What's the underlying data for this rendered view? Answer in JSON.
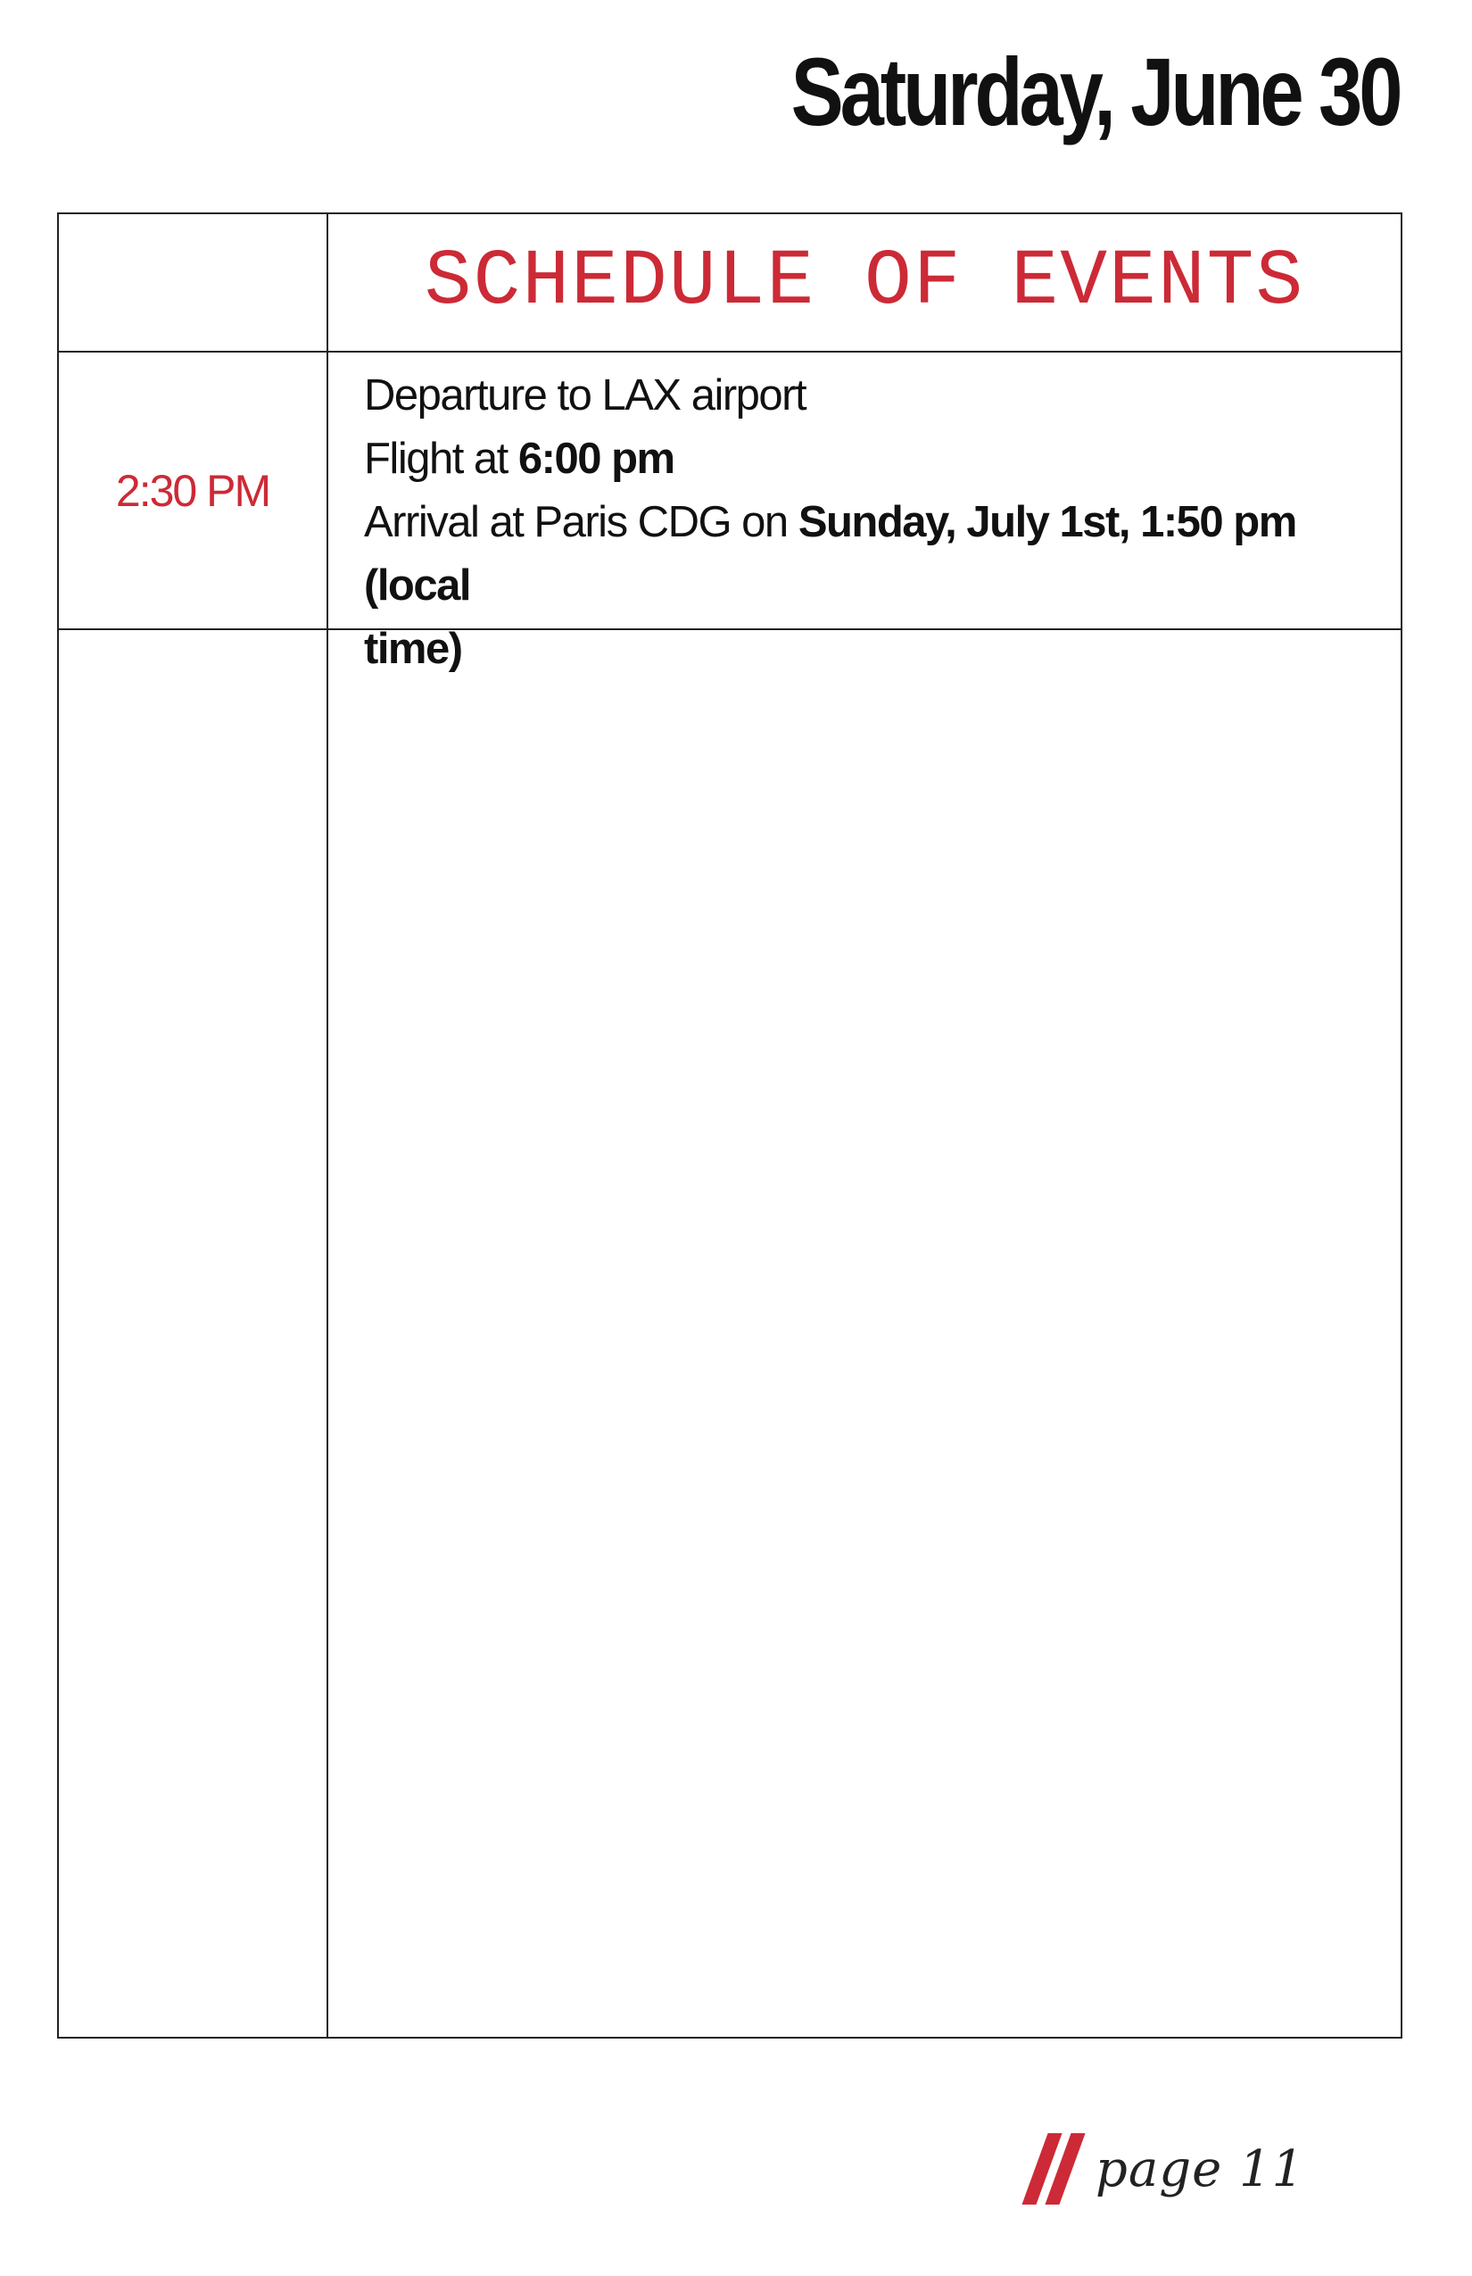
{
  "page": {
    "title": "Saturday, June 30",
    "page_label": "page 11"
  },
  "schedule": {
    "heading": "SCHEDULE OF EVENTS",
    "rows": [
      {
        "time": "2:30 PM",
        "line1": "Departure to LAX airport",
        "line2_prefix": "Flight at ",
        "line2_bold": "6:00 pm",
        "line3_prefix": "Arrival at Paris CDG on ",
        "line3_bold": "Sunday, July 1st, 1:50 pm (local",
        "line4_bold": "time)"
      }
    ]
  },
  "colors": {
    "accent_red": "#cc2a36",
    "text": "#111111",
    "border": "#222222"
  }
}
